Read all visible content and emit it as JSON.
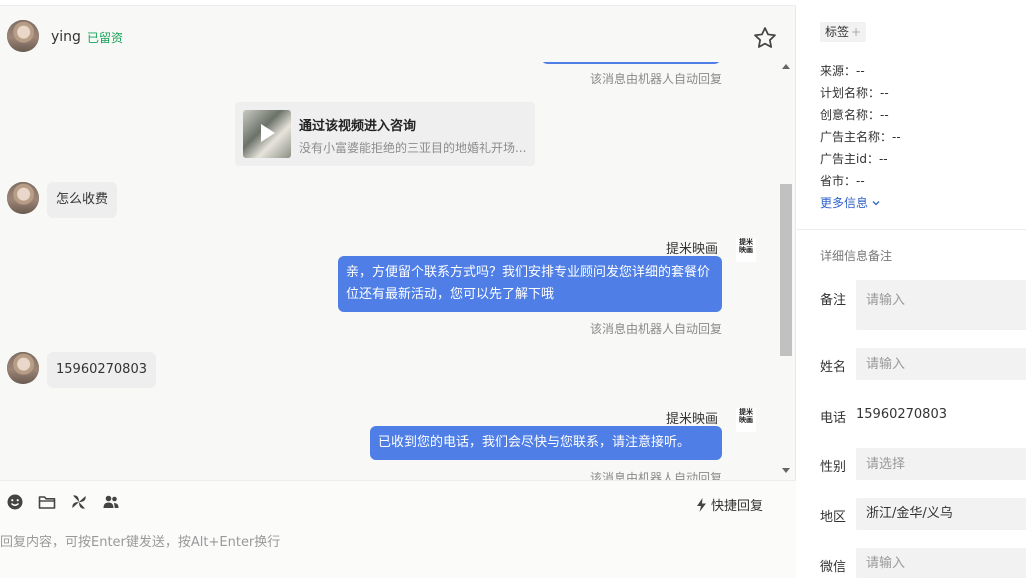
{
  "header": {
    "name": "ying",
    "badge": "已留资"
  },
  "messages": {
    "auto_note": "该消息由机器人自动回复",
    "video_card": {
      "title": "通过该视频进入咨询",
      "subtitle": "没有小富婆能拒绝的三亚目的地婚礼开场..."
    },
    "incoming_1": "怎么收费",
    "sender": "提米映画",
    "bot_logo": "提米映画",
    "outgoing_1": "亲，方便留个联系方式吗？我们安排专业顾问发您详细的套餐价位还有最新活动，您可以先了解下哦",
    "incoming_2": "15960270803",
    "outgoing_2": "已收到您的电话，我们会尽快与您联系，请注意接听。"
  },
  "composer": {
    "quick_reply": "快捷回复",
    "placeholder": "回复内容，可按Enter键发送，按Alt+Enter换行",
    "tools": [
      "emoji-icon",
      "folder-icon",
      "pinwheel-icon",
      "users-icon"
    ]
  },
  "sidebar": {
    "tag_label": "标签",
    "tag_plus": "+",
    "info": [
      {
        "label": "来源：",
        "value": "--"
      },
      {
        "label": "计划名称：",
        "value": "--"
      },
      {
        "label": "创意名称：",
        "value": "--"
      },
      {
        "label": "广告主名称：",
        "value": "--"
      },
      {
        "label": "广告主id：",
        "value": "--"
      },
      {
        "label": "省市：",
        "value": "--"
      }
    ],
    "more_info": "更多信息",
    "detail_title": "详细信息备注",
    "fields": {
      "note": {
        "label": "备注",
        "placeholder": "请输入"
      },
      "name": {
        "label": "姓名",
        "placeholder": "请输入"
      },
      "phone": {
        "label": "电话",
        "value": "15960270803"
      },
      "gender": {
        "label": "性别",
        "placeholder": "请选择"
      },
      "region": {
        "label": "地区",
        "value": "浙江/金华/义乌"
      },
      "wechat": {
        "label": "微信",
        "placeholder": "请输入"
      }
    }
  },
  "colors": {
    "accent": "#4e7ee6",
    "badge_green": "#19a35a",
    "link": "#2f62c9"
  }
}
